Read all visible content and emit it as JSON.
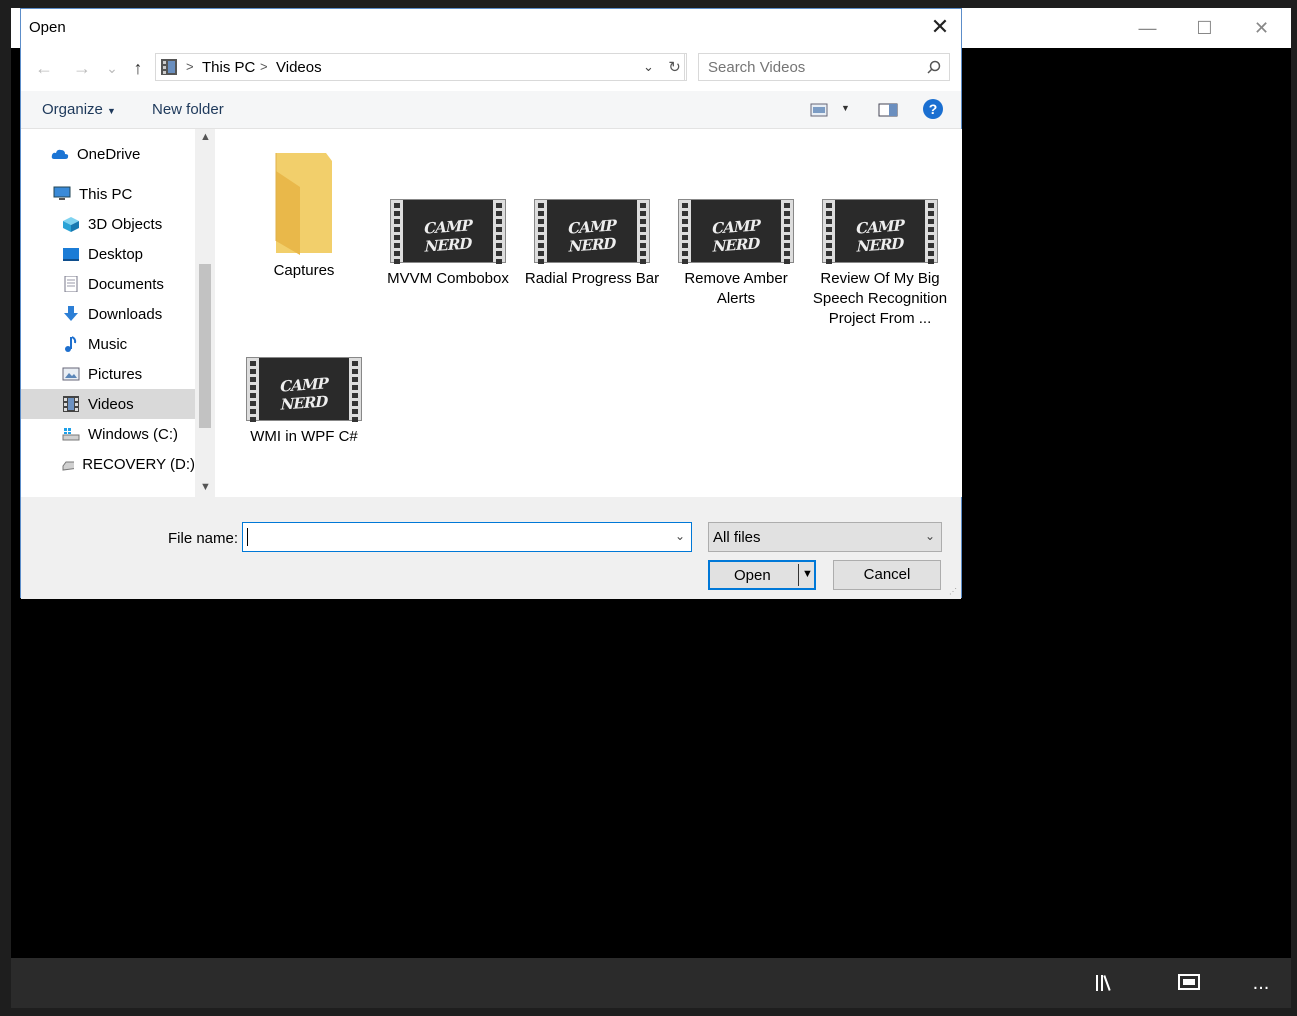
{
  "dialog": {
    "title": "Open",
    "close_glyph": "✕",
    "nav": {
      "back_glyph": "←",
      "forward_glyph": "→",
      "recent_glyph": "⌄",
      "up_glyph": "↑",
      "breadcrumb": [
        "This PC",
        "Videos"
      ],
      "refresh_glyph": "↻",
      "search_placeholder": "Search Videos"
    },
    "toolbar": {
      "organize_label": "Organize",
      "new_folder_label": "New folder"
    },
    "sidebar": {
      "items": [
        {
          "label": "OneDrive",
          "icon": "cloud-icon"
        },
        {
          "label": "This PC",
          "icon": "computer-icon"
        },
        {
          "label": "3D Objects",
          "icon": "cube-icon"
        },
        {
          "label": "Desktop",
          "icon": "desktop-icon"
        },
        {
          "label": "Documents",
          "icon": "document-icon"
        },
        {
          "label": "Downloads",
          "icon": "download-icon"
        },
        {
          "label": "Music",
          "icon": "music-icon"
        },
        {
          "label": "Pictures",
          "icon": "picture-icon"
        },
        {
          "label": "Videos",
          "icon": "video-icon",
          "selected": true
        },
        {
          "label": "Windows (C:)",
          "icon": "drive-icon"
        },
        {
          "label": "RECOVERY (D:)",
          "icon": "drive-icon"
        }
      ]
    },
    "files": [
      {
        "name": "Captures",
        "type": "folder"
      },
      {
        "name": "MVVM Combobox",
        "type": "video"
      },
      {
        "name": "Radial Progress Bar",
        "type": "video"
      },
      {
        "name": "Remove Amber Alerts",
        "type": "video"
      },
      {
        "name": "Review Of My Big Speech Recognition Project From ...",
        "type": "video"
      },
      {
        "name": "WMI in WPF C#",
        "type": "video"
      }
    ],
    "footer": {
      "file_name_label": "File name:",
      "file_name_value": "",
      "file_type_value": "All files",
      "open_label": "Open",
      "cancel_label": "Cancel"
    }
  },
  "background_app": {
    "minimize_glyph": "—",
    "maximize_glyph": "☐",
    "close_glyph": "✕",
    "more_glyph": "..."
  }
}
